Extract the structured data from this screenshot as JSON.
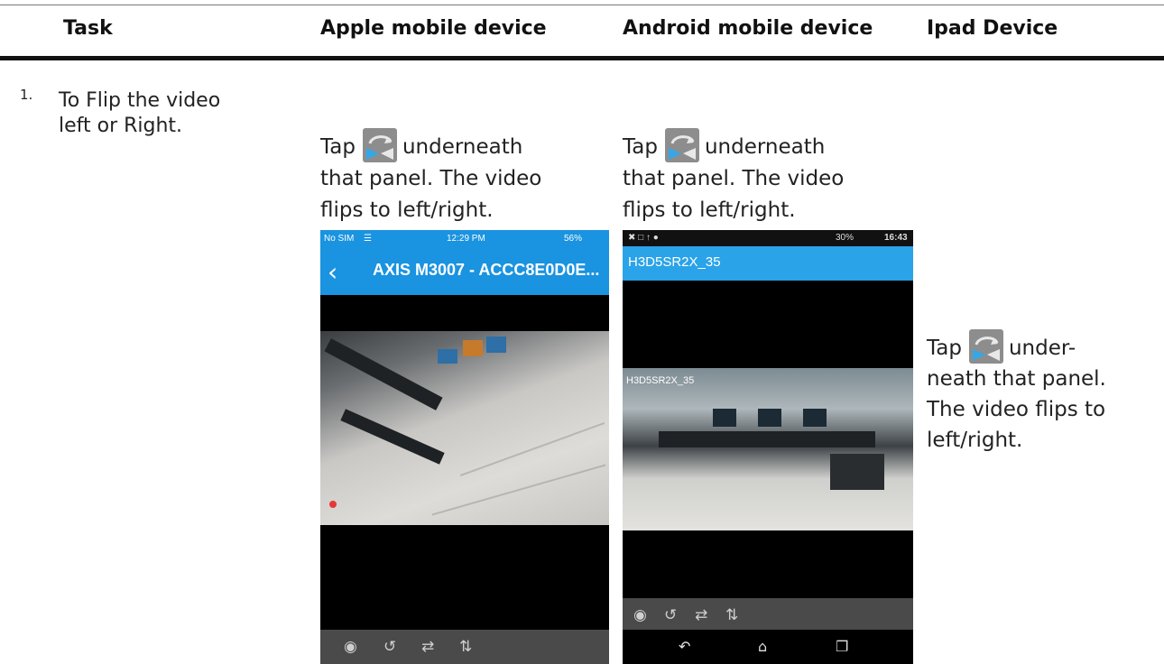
{
  "table": {
    "headers": {
      "task": "Task",
      "apple": "Apple mobile device",
      "android": "Android mobile device",
      "ipad": "Ipad Device"
    },
    "row": {
      "number": "1.",
      "task_lines": [
        "To Flip the video",
        "left or Right."
      ],
      "apple_instruction": [
        "Tap",
        "underneath",
        "that panel. The video",
        "flips to left/right."
      ],
      "android_instruction": [
        "Tap",
        "underneath",
        "that panel. The video",
        "flips to left/right."
      ],
      "ipad_instruction": [
        "Tap",
        "under-",
        "neath that panel.",
        "The video flips to",
        "left/right."
      ]
    }
  },
  "ios_screenshot": {
    "carrier": "No SIM",
    "wifi_icon": "wifi-icon",
    "time": "12:29 PM",
    "battery": "56%",
    "back_icon": "chevron-left-icon",
    "title": "AXIS M3007 - ACCC8E0D0E...",
    "toolbar_icons": [
      "camera-icon",
      "rotate-icon",
      "flip-horizontal-icon",
      "flip-vertical-icon"
    ]
  },
  "android_screenshot": {
    "status_time": "16:43",
    "status_battery": "30%",
    "title": "H3D5SR2X_35",
    "overlay_label": "H3D5SR2X_35",
    "toolbar_icons": [
      "camera-icon",
      "rotate-icon",
      "flip-horizontal-icon",
      "flip-vertical-icon"
    ],
    "softkeys": [
      "back-icon",
      "home-icon",
      "recents-icon"
    ]
  },
  "colors": {
    "ios_bar": "#1a93e0",
    "android_bar": "#2aa3e8",
    "toolbar": "#4a4a4a",
    "header_rule": "#111111"
  }
}
